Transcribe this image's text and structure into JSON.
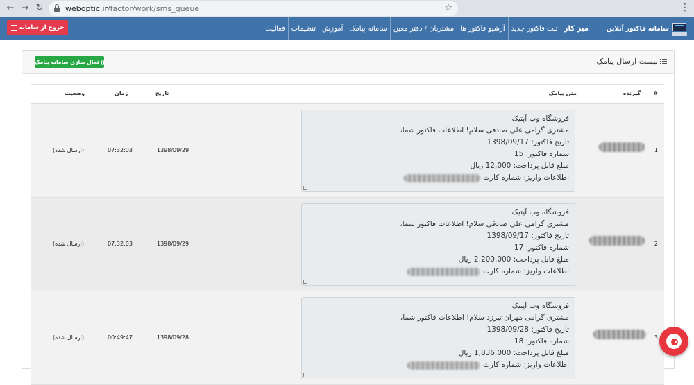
{
  "browser": {
    "url_domain": "weboptic.ir",
    "url_path": "/factor/work/sms_queue"
  },
  "navbar": {
    "brand_title": "سامانه فاکتور آنلاین",
    "menu": [
      "میز کار",
      "ثبت فاکتور جدید",
      "آرشیو فاکتور ها",
      "مشتریان / دفتر معین",
      "سامانه پیامک",
      "آموزش",
      "تنظیمات",
      "فعالیت"
    ],
    "logout_label": "خروج از سامانه"
  },
  "panel": {
    "title": "لیست ارسال پیامک",
    "activate_label": "فعال سازی سامانه پیامک"
  },
  "table": {
    "headers": {
      "index": "#",
      "recipient": "گیرنده",
      "message": "متن پیامک",
      "date": "تاریخ",
      "time": "زمان",
      "status": "وضعیت"
    },
    "rows": [
      {
        "index": "1",
        "date": "1398/09/29",
        "time": "07:32:03",
        "status": "(ارسال شده)",
        "message": [
          "فروشگاه وب آپتیک",
          "مشتری گرامی علی صادقی سلام! اطلاعات فاکتور شما،",
          "تاریخ فاکتور: 1398/09/17",
          "شماره فاکتور: 15",
          "مبلغ قابل پرداخت: 12,000 ریال",
          "اطلاعات واریز: شماره کارت"
        ]
      },
      {
        "index": "2",
        "date": "1398/09/29",
        "time": "07:32:03",
        "status": "(ارسال شده)",
        "message": [
          "فروشگاه وب آپتیک",
          "مشتری گرامی علی صادقی سلام! اطلاعات فاکتور شما،",
          "تاریخ فاکتور: 1398/09/17",
          "شماره فاکتور: 17",
          "مبلغ قابل پرداخت: 2,200,000 ریال",
          "اطلاعات واریز: شماره کارت"
        ]
      },
      {
        "index": "3",
        "date": "1398/09/28",
        "time": "00:49:47",
        "status": "(ارسال شده)",
        "message": [
          "فروشگاه وب آپتیک",
          "مشتری گرامی مهران تیرزد سلام! اطلاعات فاکتور شما،",
          "تاریخ فاکتور: 1398/09/28",
          "شماره فاکتور: 18",
          "مبلغ قابل پرداخت: 1,836,000 ریال",
          "اطلاعات واریز: شماره کارت"
        ]
      }
    ]
  },
  "icons": {
    "back": "arrow-left-icon",
    "forward": "arrow-right-icon",
    "reload": "reload-icon",
    "lock": "lock-icon",
    "star": "star-icon",
    "list": "list-icon",
    "check": "check-circle-icon",
    "logout": "sign-out-icon",
    "chat": "chat-widget-icon"
  },
  "colors": {
    "navbar": "#3f73aa",
    "logout_button": "#e63a4d",
    "activate_button": "#28a745",
    "chat_widget": "#e8363e"
  }
}
